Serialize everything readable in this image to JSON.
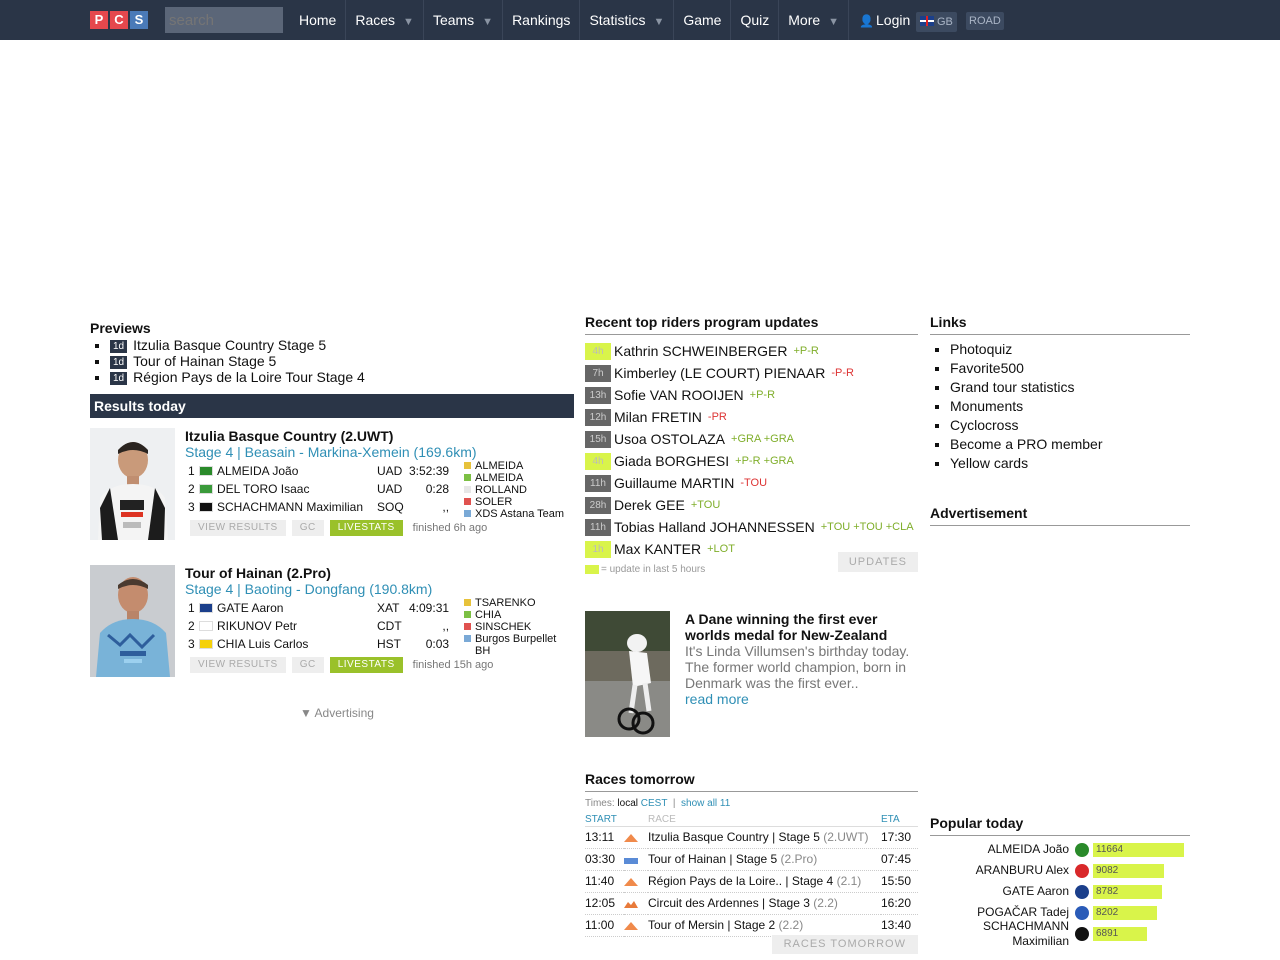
{
  "nav": {
    "logo": [
      "P",
      "C",
      "S"
    ],
    "search_placeholder": "search",
    "items": [
      {
        "label": "Home",
        "caret": false
      },
      {
        "label": "Races",
        "caret": true
      },
      {
        "label": "Teams",
        "caret": true
      },
      {
        "label": "Rankings",
        "caret": false
      },
      {
        "label": "Statistics",
        "caret": true
      },
      {
        "label": "Game",
        "caret": false
      },
      {
        "label": "Quiz",
        "caret": false
      },
      {
        "label": "More",
        "caret": true
      }
    ],
    "login": "Login",
    "lang": "GB",
    "mode": "ROAD"
  },
  "previews": {
    "title": "Previews",
    "items": [
      {
        "badge": "1d",
        "label": "Itzulia Basque Country Stage 5"
      },
      {
        "badge": "1d",
        "label": "Tour of Hainan Stage 5"
      },
      {
        "badge": "1d",
        "label": "Région Pays de la Loire Tour Stage 4"
      }
    ]
  },
  "results": {
    "title": "Results today",
    "races": [
      {
        "title": "Itzulia Basque Country (2.UWT)",
        "stage": "Stage 4 | Beasain - Markina-Xemein (169.6km)",
        "rows": [
          {
            "pos": "1",
            "name": "ALMEIDA João",
            "team": "UAD",
            "time": "3:52:39",
            "flag": "#2a8a2a"
          },
          {
            "pos": "2",
            "name": "DEL TORO Isaac",
            "team": "UAD",
            "time": "0:28",
            "flag": "#3a9a3a"
          },
          {
            "pos": "3",
            "name": "SCHACHMANN Maximilian",
            "team": "SOQ",
            "time": ",,",
            "flag": "#111111"
          }
        ],
        "jerseys": [
          {
            "color": "#e7c23b",
            "label": "ALMEIDA"
          },
          {
            "color": "#7cc044",
            "label": "ALMEIDA"
          },
          {
            "color": "#e7e7e7",
            "label": "ROLLAND"
          },
          {
            "color": "#e0524f",
            "label": "SOLER"
          },
          {
            "color": "#7aa9d6",
            "label": "XDS Astana Team"
          }
        ],
        "buttons": [
          "VIEW RESULTS",
          "GC",
          "LIVESTATS"
        ],
        "finished": "finished 6h ago"
      },
      {
        "title": "Tour of Hainan (2.Pro)",
        "stage": "Stage 4 | Baoting - Dongfang (190.8km)",
        "rows": [
          {
            "pos": "1",
            "name": "GATE Aaron",
            "team": "XAT",
            "time": "4:09:31",
            "flag": "#1b3f8b"
          },
          {
            "pos": "2",
            "name": "RIKUNOV Petr",
            "team": "CDT",
            "time": ",,",
            "flag": "#ffffff"
          },
          {
            "pos": "3",
            "name": "CHIA Luis Carlos",
            "team": "HST",
            "time": "0:03",
            "flag": "#f5d10a"
          }
        ],
        "jerseys": [
          {
            "color": "#e7c23b",
            "label": "TSARENKO"
          },
          {
            "color": "#7cc044",
            "label": "CHIA"
          },
          {
            "color": "#e0524f",
            "label": "SINSCHEK"
          },
          {
            "color": "#7aa9d6",
            "label": "Burgos Burpellet BH"
          }
        ],
        "buttons": [
          "VIEW RESULTS",
          "GC",
          "LIVESTATS"
        ],
        "finished": "finished 15h ago"
      }
    ],
    "advertising": "▼ Advertising"
  },
  "updates": {
    "title": "Recent top riders program updates",
    "rows": [
      {
        "age": "4h",
        "lime": true,
        "name": "Kathrin SCHWEINBERGER",
        "changes": [
          {
            "t": "+P-R",
            "kind": "plus"
          }
        ]
      },
      {
        "age": "7h",
        "lime": false,
        "name": "Kimberley (LE COURT) PIENAAR",
        "changes": [
          {
            "t": "-P-R",
            "kind": "minus"
          }
        ]
      },
      {
        "age": "13h",
        "lime": false,
        "name": "Sofie VAN ROOIJEN",
        "changes": [
          {
            "t": "+P-R",
            "kind": "plus"
          }
        ]
      },
      {
        "age": "12h",
        "lime": false,
        "name": "Milan FRETIN",
        "changes": [
          {
            "t": "-PR",
            "kind": "minus"
          }
        ]
      },
      {
        "age": "15h",
        "lime": false,
        "name": "Usoa OSTOLAZA",
        "changes": [
          {
            "t": "+GRA +GRA",
            "kind": "plus"
          }
        ]
      },
      {
        "age": "4h",
        "lime": true,
        "name": "Giada BORGHESI",
        "changes": [
          {
            "t": "+P-R +GRA",
            "kind": "plus"
          }
        ]
      },
      {
        "age": "11h",
        "lime": false,
        "name": "Guillaume MARTIN",
        "changes": [
          {
            "t": "-TOU",
            "kind": "minus"
          }
        ]
      },
      {
        "age": "28h",
        "lime": false,
        "name": "Derek GEE",
        "changes": [
          {
            "t": "+TOU",
            "kind": "plus"
          }
        ]
      },
      {
        "age": "11h",
        "lime": false,
        "name": "Tobias Halland JOHANNESSEN",
        "changes": [
          {
            "t": "+TOU +TOU +CLA",
            "kind": "plus"
          }
        ]
      },
      {
        "age": "1h",
        "lime": true,
        "name": "Max KANTER",
        "changes": [
          {
            "t": "+LOT",
            "kind": "plus"
          }
        ]
      }
    ],
    "legend": "= update in last 5 hours",
    "button": "UPDATES"
  },
  "news": {
    "headline": "A Dane winning the first ever worlds medal for New-Zealand",
    "body": "It's Linda Villumsen's birthday today. The former world champion, born in Denmark was the first ever..",
    "more": "read more"
  },
  "tomorrow": {
    "title": "Races tomorrow",
    "times_label": "Times:",
    "local": "local",
    "cest": "CEST",
    "sep": "|",
    "show_all": "show all 11",
    "headers": {
      "start": "START",
      "race": "RACE",
      "eta": "ETA"
    },
    "rows": [
      {
        "start": "13:11",
        "race": "Itzulia Basque Country | Stage 5",
        "cls": "(2.UWT)",
        "eta": "17:30",
        "profile": "mountain"
      },
      {
        "start": "03:30",
        "race": "Tour of Hainan | Stage 5",
        "cls": "(2.Pro)",
        "eta": "07:45",
        "profile": "flat"
      },
      {
        "start": "11:40",
        "race": "Région Pays de la Loire.. | Stage 4",
        "cls": "(2.1)",
        "eta": "15:50",
        "profile": "mountain"
      },
      {
        "start": "12:05",
        "race": "Circuit des Ardennes | Stage 3",
        "cls": "(2.2)",
        "eta": "16:20",
        "profile": "hilly"
      },
      {
        "start": "11:00",
        "race": "Tour of Mersin | Stage 2",
        "cls": "(2.2)",
        "eta": "13:40",
        "profile": "mountain"
      }
    ],
    "button": "RACES TOMORROW"
  },
  "links": {
    "title": "Links",
    "items": [
      "Photoquiz",
      "Favorite500",
      "Grand tour statistics",
      "Monuments",
      "Cyclocross",
      "Become a PRO member",
      "Yellow cards"
    ]
  },
  "advertisement": {
    "title": "Advertisement"
  },
  "popular": {
    "title": "Popular today",
    "rows": [
      {
        "name": "ALMEIDA João",
        "value": "11664",
        "share": 1.0,
        "flag": "#2a8a2a"
      },
      {
        "name": "ARANBURU Alex",
        "value": "9082",
        "share": 0.778,
        "flag": "#d9282a"
      },
      {
        "name": "GATE Aaron",
        "value": "8782",
        "share": 0.753,
        "flag": "#1b3f8b"
      },
      {
        "name": "POGAČAR Tadej",
        "value": "8202",
        "share": 0.703,
        "flag": "#2a5bb8"
      },
      {
        "name": "SCHACHMANN Maximilian",
        "value": "6891",
        "share": 0.591,
        "flag": "#111111"
      }
    ]
  }
}
